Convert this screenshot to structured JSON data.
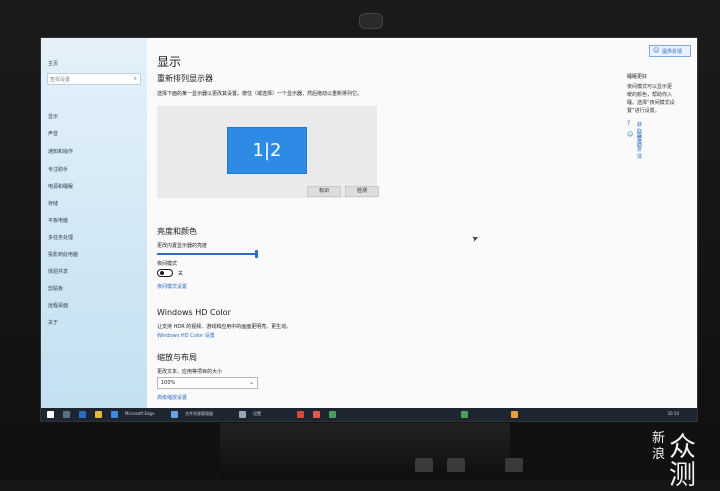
{
  "sidebar": {
    "home": "主页",
    "search_placeholder": "查找设置",
    "search_icon": "search-icon",
    "items": [
      "显示",
      "声音",
      "通知和操作",
      "专注助手",
      "电源和睡眠",
      "存储",
      "平板电脑",
      "多任务处理",
      "投影到此电脑",
      "体验共享",
      "剪贴板",
      "远程桌面",
      "关于"
    ]
  },
  "main": {
    "page_title": "显示",
    "arrange_title": "重新排列显示器",
    "arrange_desc": "选择下面的某一显示器以更改其设置。按住（或选择）一个显示器，然后拖动以重新排列它。",
    "monitor_label": "1|2",
    "identify_label": "标识",
    "detect_label": "检测",
    "brightness_title": "亮度和颜色",
    "brightness_label": "更改内置显示器的亮度",
    "brightness_value": 1.0,
    "nightlight_label": "夜间模式",
    "nightlight_state": "关",
    "nightlight_link": "夜间模式设置",
    "hdr_title": "Windows HD Color",
    "hdr_desc": "让支持 HDR 的视频、游戏和应用中的画面更明亮、更生动。",
    "hdr_link": "Windows HD Color 设置",
    "scale_title": "缩放与布局",
    "scale_label": "更改文本、应用等项目的大小",
    "scale_value": "100%",
    "scale_link": "高级缩放设置"
  },
  "right": {
    "feedback_label": "提供反馈",
    "sleep_title": "睡眠更好",
    "sleep_desc": "夜间模式可以显示更暖的颜色，帮助你入睡。选择“夜间模式设置”进行设置。",
    "help_link": "获取帮助",
    "feedback_link": "提供反馈"
  },
  "taskbar": {
    "apps": [
      "任务视图",
      "Microsoft Edge",
      "文件资源管理器",
      "设置"
    ],
    "clock": "20:10"
  },
  "watermark": {
    "line1": "新",
    "line2": "浪",
    "line3": "众测"
  },
  "colors": {
    "accent": "#2b6cc4",
    "monitor_blue": "#2d8be6",
    "sidebar_top": "#e4f1f9",
    "sidebar_bottom": "#c3e0f1"
  }
}
